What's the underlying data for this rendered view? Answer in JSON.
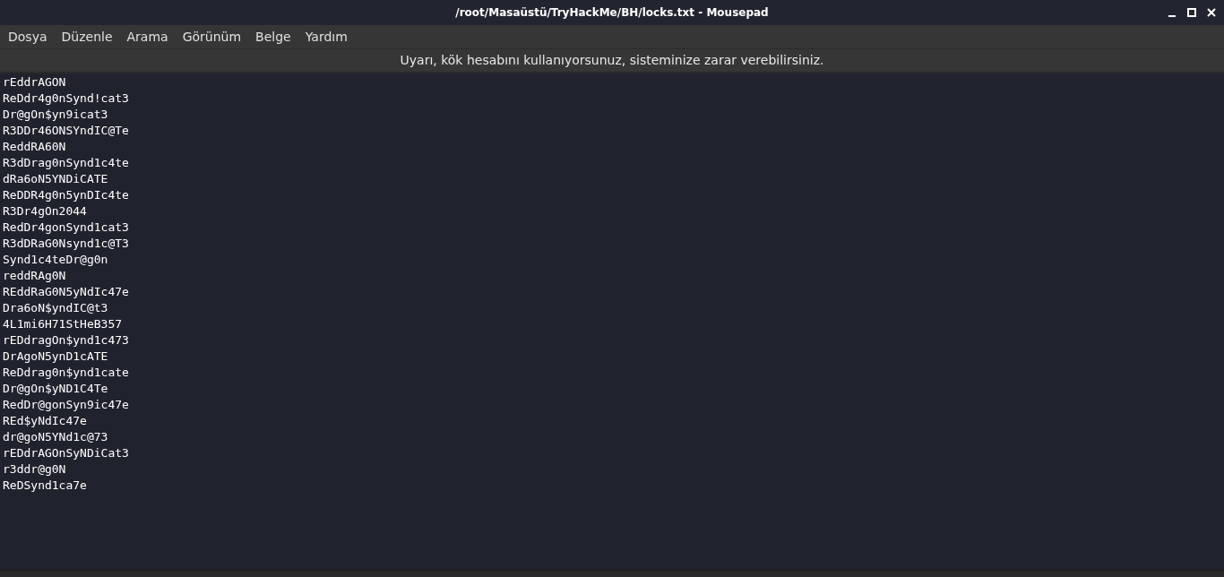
{
  "window": {
    "title": "/root/Masaüstü/TryHackMe/BH/locks.txt - Mousepad"
  },
  "menu": [
    "Dosya",
    "Düzenle",
    "Arama",
    "Görünüm",
    "Belge",
    "Yardım"
  ],
  "warning": "Uyarı, kök hesabını kullanıyorsunuz, sisteminize zarar verebilirsiniz.",
  "editor": {
    "lines": [
      "rEddrAGON",
      "ReDdr4g0nSynd!cat3",
      "Dr@gOn$yn9icat3",
      "R3DDr46ONSYndIC@Te",
      "ReddRA60N",
      "R3dDrag0nSynd1c4te",
      "dRa6oN5YNDiCATE",
      "ReDDR4g0n5ynDIc4te",
      "R3Dr4gOn2044",
      "RedDr4gonSynd1cat3",
      "R3dDRaG0Nsynd1c@T3",
      "Synd1c4teDr@g0n",
      "reddRAg0N",
      "REddRaG0N5yNdIc47e",
      "Dra6oN$yndIC@t3",
      "4L1mi6H71StHeB357",
      "rEDdragOn$ynd1c473",
      "DrAgoN5ynD1cATE",
      "ReDdrag0n$ynd1cate",
      "Dr@gOn$yND1C4Te",
      "RedDr@gonSyn9ic47e",
      "REd$yNdIc47e",
      "dr@goN5YNd1c@73",
      "rEDdrAGOnSyNDiCat3",
      "r3ddr@g0N",
      "ReDSynd1ca7e"
    ]
  }
}
